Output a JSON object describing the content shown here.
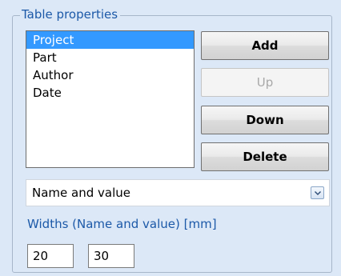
{
  "group": {
    "title": "Table properties"
  },
  "list": {
    "items": [
      {
        "label": "Project",
        "selected": true
      },
      {
        "label": "Part",
        "selected": false
      },
      {
        "label": "Author",
        "selected": false
      },
      {
        "label": "Date",
        "selected": false
      }
    ]
  },
  "buttons": {
    "add": "Add",
    "up": "Up",
    "down": "Down",
    "delete": "Delete"
  },
  "display_mode": {
    "selected": "Name and value"
  },
  "widths": {
    "label": "Widths (Name and value) [mm]",
    "name_width": "20",
    "value_width": "30"
  },
  "colors": {
    "panel_background": "#dce8f7",
    "label_text": "#1c59a8",
    "selection": "#3399ff"
  },
  "icons": {
    "combo_arrow": "chevron-down-icon"
  }
}
